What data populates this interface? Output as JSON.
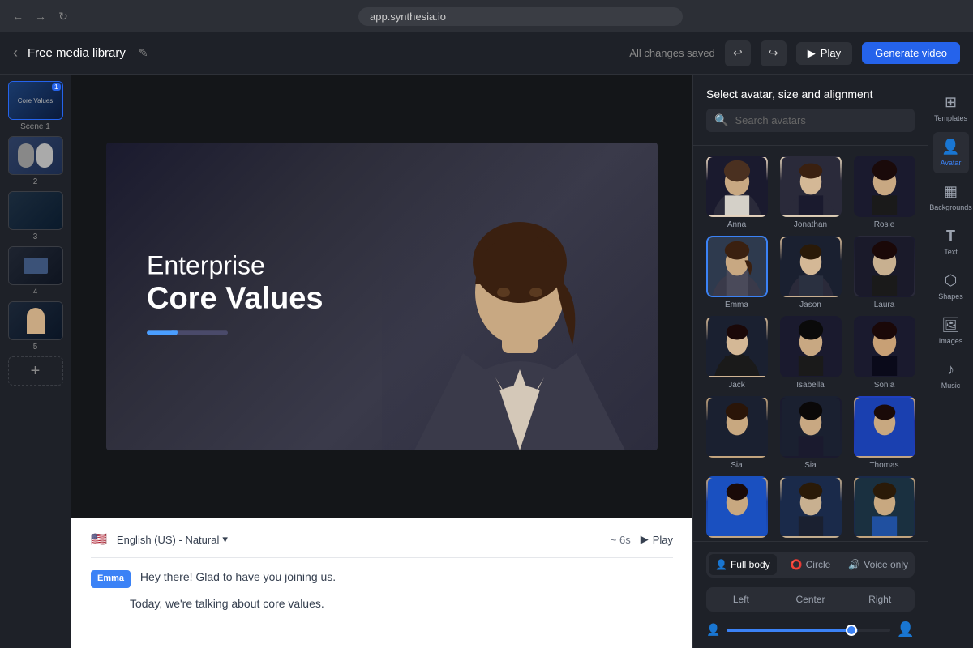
{
  "browser": {
    "url": "app.synthesia.io"
  },
  "topbar": {
    "title": "Free media library",
    "status": "All changes saved",
    "play_label": "Play",
    "generate_label": "Generate video"
  },
  "scenes": [
    {
      "id": 1,
      "label": "Scene 1",
      "active": true
    },
    {
      "id": 2,
      "label": "2",
      "active": false
    },
    {
      "id": 3,
      "label": "3",
      "active": false
    },
    {
      "id": 4,
      "label": "4",
      "active": false
    },
    {
      "id": 5,
      "label": "5",
      "active": false
    }
  ],
  "canvas": {
    "title_light": "Enterprise",
    "title_bold": "Core Values"
  },
  "script": {
    "language": "English (US) - Natural",
    "duration": "~ 6s",
    "play_label": "Play",
    "avatar_name": "Emma",
    "line1": "Hey there! Glad to have you joining us.",
    "line2": "Today, we're talking about core values."
  },
  "avatar_panel": {
    "title": "Select avatar, size and alignment",
    "search_placeholder": "Search avatars",
    "avatars": [
      {
        "id": "anna",
        "name": "Anna",
        "selected": false
      },
      {
        "id": "jonathan",
        "name": "Jonathan",
        "selected": false
      },
      {
        "id": "rosie",
        "name": "Rosie",
        "selected": false
      },
      {
        "id": "emma",
        "name": "Emma",
        "selected": true
      },
      {
        "id": "jason",
        "name": "Jason",
        "selected": false
      },
      {
        "id": "laura",
        "name": "Laura",
        "selected": false
      },
      {
        "id": "jack",
        "name": "Jack",
        "selected": false
      },
      {
        "id": "isabella",
        "name": "Isabella",
        "selected": false
      },
      {
        "id": "sonia",
        "name": "Sonia",
        "selected": false
      },
      {
        "id": "sia1",
        "name": "Sia",
        "selected": false
      },
      {
        "id": "sia2",
        "name": "Sia",
        "selected": false
      },
      {
        "id": "thomas",
        "name": "Thomas",
        "selected": false
      },
      {
        "id": "row4a",
        "name": "",
        "selected": false
      },
      {
        "id": "row4b",
        "name": "",
        "selected": false
      },
      {
        "id": "row4c",
        "name": "",
        "selected": false
      }
    ],
    "size_tabs": [
      {
        "id": "full-body",
        "label": "Full body",
        "active": true
      },
      {
        "id": "circle",
        "label": "Circle",
        "active": false
      },
      {
        "id": "voice-only",
        "label": "Voice only",
        "active": false
      }
    ],
    "align_options": [
      {
        "id": "left",
        "label": "Left",
        "active": false
      },
      {
        "id": "center",
        "label": "Center",
        "active": false
      },
      {
        "id": "right",
        "label": "Right",
        "active": false
      }
    ],
    "slider_value": 80
  },
  "right_sidebar": {
    "items": [
      {
        "id": "templates",
        "label": "Templates",
        "icon": "⊞"
      },
      {
        "id": "avatar",
        "label": "Avatar",
        "icon": "👤",
        "active": true
      },
      {
        "id": "backgrounds",
        "label": "Backgrounds",
        "icon": "▦"
      },
      {
        "id": "text",
        "label": "Text",
        "icon": "T"
      },
      {
        "id": "shapes",
        "label": "Shapes",
        "icon": "⬡"
      },
      {
        "id": "images",
        "label": "Images",
        "icon": "🖼"
      },
      {
        "id": "music",
        "label": "Music",
        "icon": "♪"
      }
    ]
  }
}
